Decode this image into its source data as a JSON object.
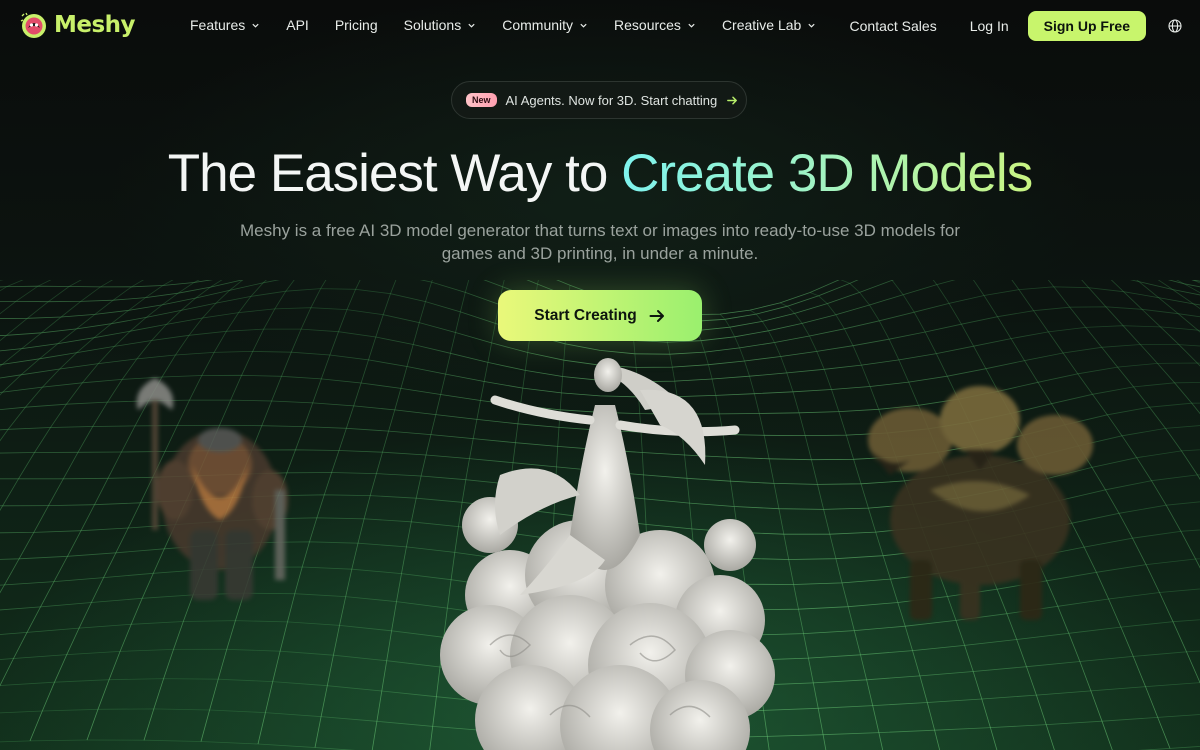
{
  "brand": {
    "name": "Meshy"
  },
  "nav": {
    "items": [
      {
        "label": "Features",
        "has_dropdown": true
      },
      {
        "label": "API",
        "has_dropdown": false
      },
      {
        "label": "Pricing",
        "has_dropdown": false
      },
      {
        "label": "Solutions",
        "has_dropdown": true
      },
      {
        "label": "Community",
        "has_dropdown": true
      },
      {
        "label": "Resources",
        "has_dropdown": true
      },
      {
        "label": "Creative Lab",
        "has_dropdown": true
      }
    ],
    "contact_sales": "Contact Sales",
    "login": "Log In",
    "signup": "Sign Up Free",
    "language_icon": "globe-icon"
  },
  "announcement": {
    "badge": "New",
    "text": "AI Agents. Now for 3D. Start chatting"
  },
  "hero": {
    "headline_plain": "The Easiest Way to ",
    "headline_highlight": "Create 3D Models",
    "subtitle": "Meshy is a free AI 3D model generator that turns text or images into ready-to-use 3D models for games and 3D printing, in under a minute.",
    "cta_label": "Start Creating"
  },
  "colors": {
    "accent": "#c8f56c",
    "background": "#0b0f0c",
    "gradient_start": "#7ef3ee",
    "gradient_end": "#c9f482",
    "badge": "#ffa9b6"
  },
  "showcase": {
    "models": [
      "dwarf-warrior-model",
      "goddess-statue-model",
      "three-headed-dog-model"
    ]
  }
}
